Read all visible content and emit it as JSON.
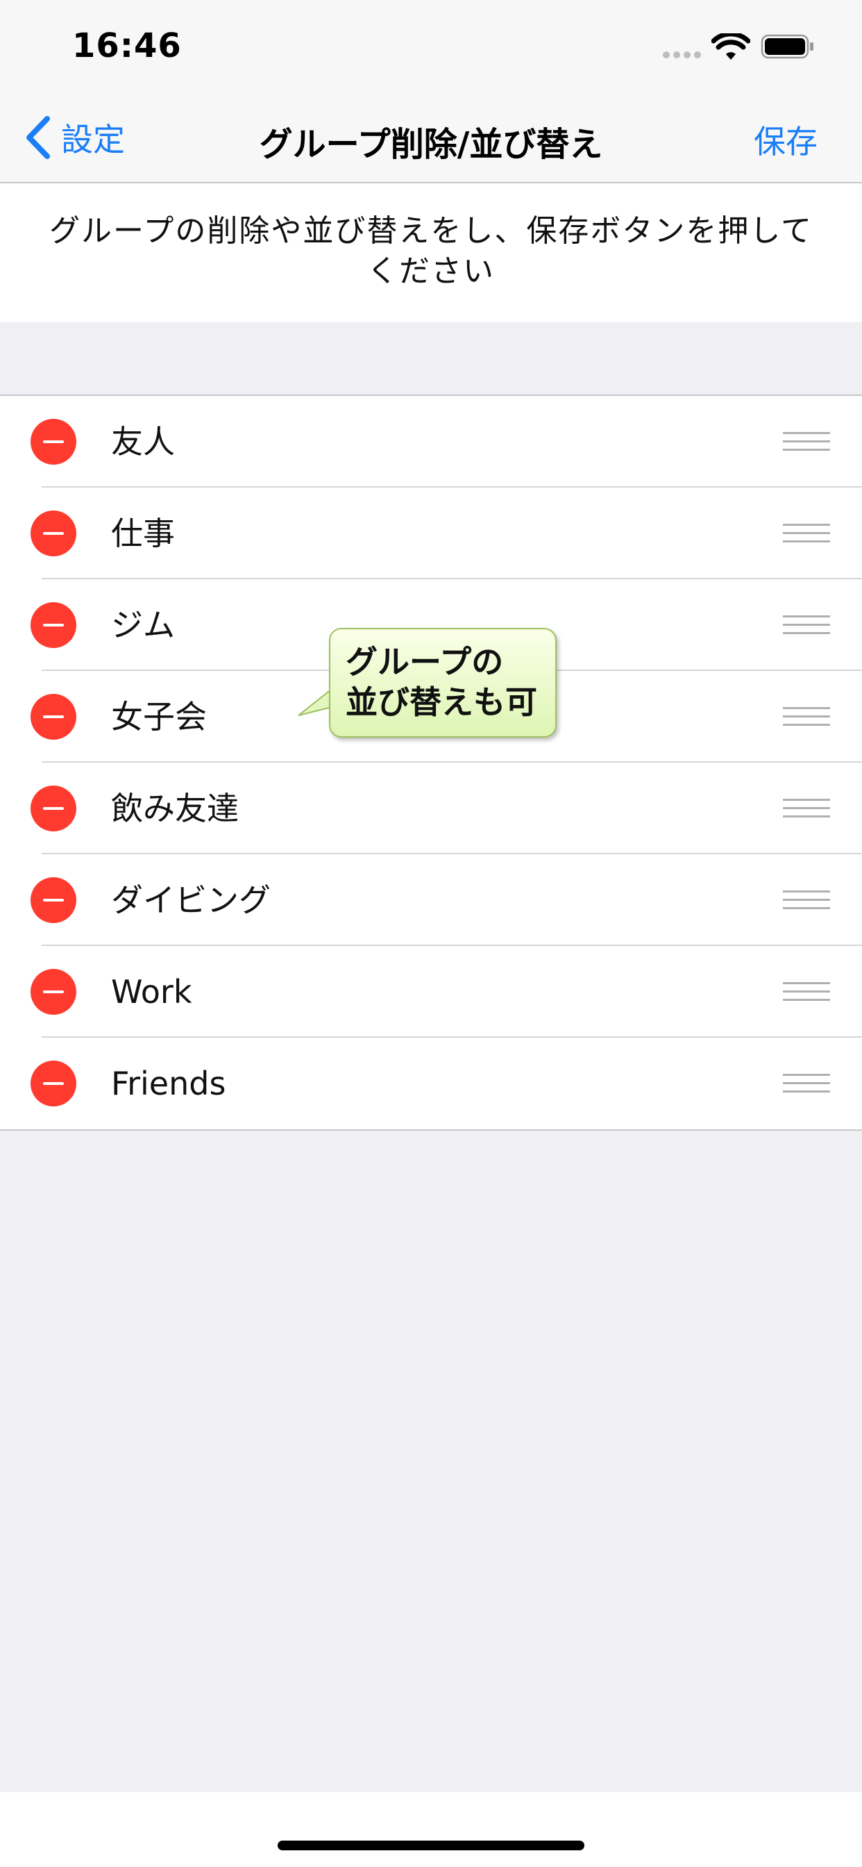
{
  "status_bar": {
    "time": "16:46"
  },
  "nav": {
    "back_label": "設定",
    "title": "グループ削除/並び替え",
    "save_label": "保存"
  },
  "instruction": {
    "text": "グループの削除や並び替えをし、保存ボタンを押してください"
  },
  "groups": [
    {
      "label": "友人"
    },
    {
      "label": "仕事"
    },
    {
      "label": "ジム"
    },
    {
      "label": "女子会"
    },
    {
      "label": "飲み友達"
    },
    {
      "label": "ダイビング"
    },
    {
      "label": "Work"
    },
    {
      "label": "Friends"
    }
  ],
  "callout": {
    "line1": "グループの",
    "line2": "並び替えも可"
  },
  "colors": {
    "accent": "#1A7EF7",
    "delete": "#FF3B30",
    "callout_fill": "#E7F8C7",
    "background": "#EFEFF4"
  },
  "icons": {
    "back": "chevron-left-icon",
    "wifi": "wifi-icon",
    "battery": "battery-icon",
    "signal": "signal-dots-icon",
    "delete": "minus-circle-icon",
    "reorder": "reorder-handle-icon"
  }
}
